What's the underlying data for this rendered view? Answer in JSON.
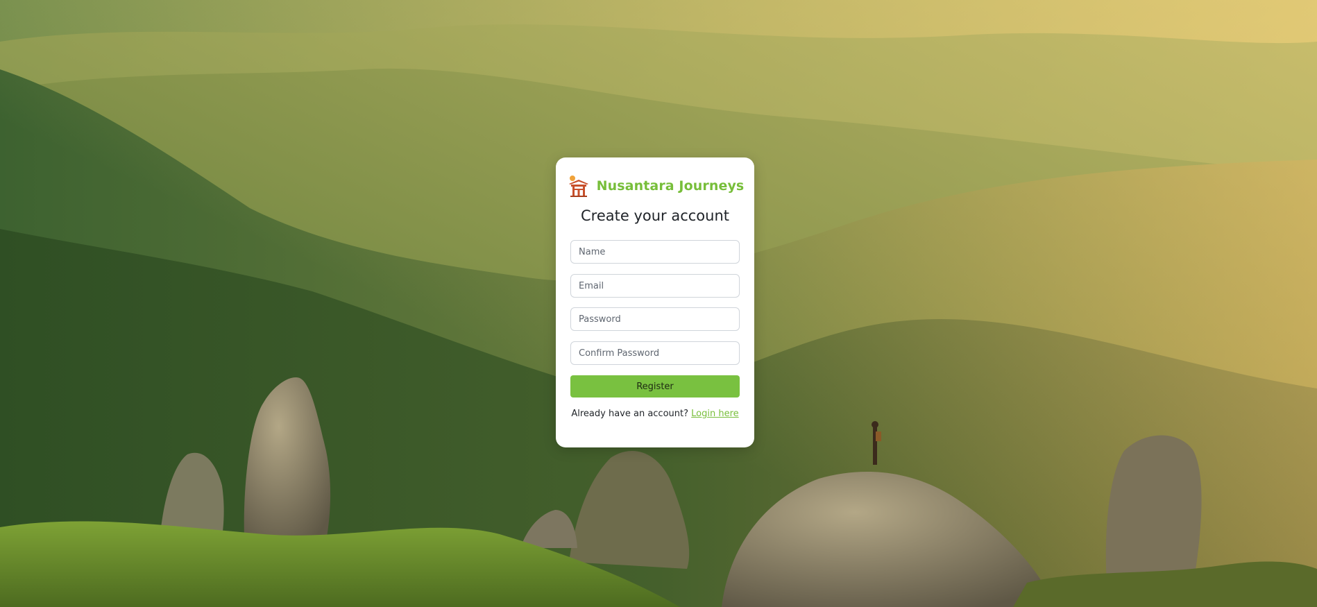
{
  "app": {
    "brand_name": "Nusantara Journeys",
    "brand_color": "#77be3a",
    "logo_icon": "temple-gate-icon"
  },
  "background": {
    "description": "mountain-landscape-photo",
    "colors": {
      "sky_haze": "#c7b568",
      "far_hills": "#8f9a4c",
      "mid_forest": "#4e6e34",
      "near_forest": "#3c5a28",
      "rocks": "#8a8066",
      "meadow": "#7f9d33"
    }
  },
  "form": {
    "heading": "Create your account",
    "name_placeholder": "Name",
    "email_placeholder": "Email",
    "password_placeholder": "Password",
    "confirm_placeholder": "Confirm Password",
    "submit_label": "Register",
    "submit_color": "#79c140",
    "footer_text": "Already have an account?",
    "login_link": "Login here"
  }
}
